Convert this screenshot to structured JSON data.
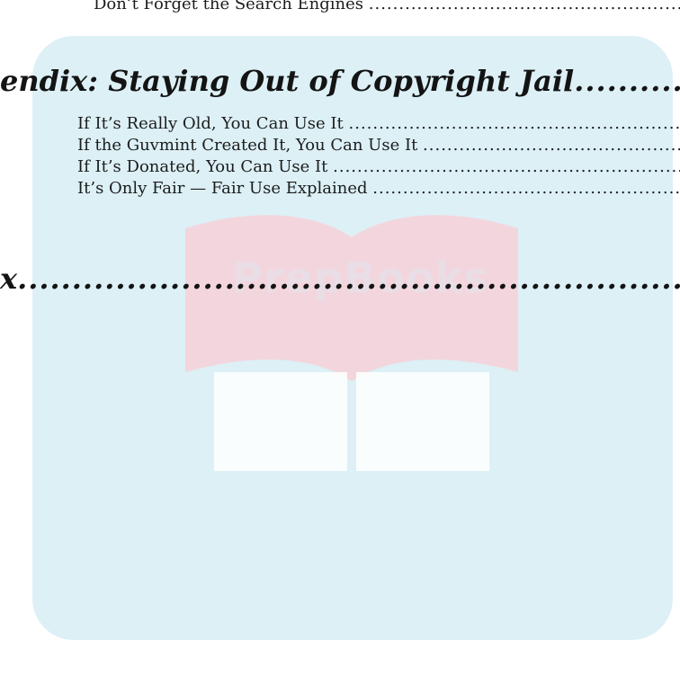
{
  "toc": {
    "top_entry": "Don’t Forget the Search Engines",
    "appendix_heading": "endix: Staying Out of Copyright Jail",
    "appendix_entries": [
      "If It’s Really Old, You Can Use It",
      "If the Guvmint Created It, You Can Use It",
      "If It’s Donated, You Can Use It",
      "It’s Only Fair — Fair Use Explained"
    ],
    "index_heading": "x"
  },
  "watermark": {
    "text": "PrepBooks",
    "panel_color": "#dcf0f6",
    "book_color": "#f3d6dd"
  }
}
